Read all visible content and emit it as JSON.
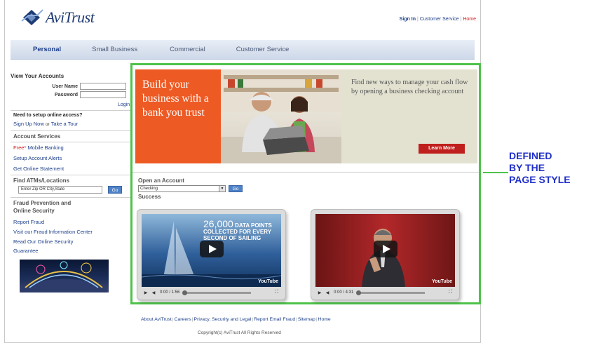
{
  "brand": {
    "name": "AviTrust"
  },
  "header": {
    "sign_in": "Sign In",
    "customer_service": "Customer Service",
    "home": "Home"
  },
  "nav": {
    "tabs": [
      "Personal",
      "Small Business",
      "Commercial",
      "Customer Service"
    ],
    "active": "Personal"
  },
  "sidebar": {
    "accounts_title": "View Your Accounts",
    "username_label": "User Name",
    "password_label": "Password",
    "login": "Login",
    "need_setup": "Need to setup online access?",
    "sign_up_now": "Sign Up Now",
    "or": "or",
    "take_tour": "Take a Tour",
    "services_title": "Account Services",
    "free_badge": "Free*",
    "mobile_banking": "Mobile Banking",
    "setup_alerts": "Setup Account Alerts",
    "online_statement": "Get Online Statement",
    "find_atms_title": "Find ATMs/Locations",
    "zip_placeholder": "Enter Zip OR City,State",
    "go": "Go",
    "fraud_title_1": "Fraud Prevention and",
    "fraud_title_2": "Online Security",
    "report_fraud": "Report Fraud",
    "fraud_center": "Visit our Fraud Information Center",
    "read_security": "Read Our Online Security",
    "guarantee": "Guarantee"
  },
  "banner": {
    "headline": "Build your business with a bank you trust",
    "right_text": "Find new ways to manage your cash flow by opening a business checking account",
    "learn_more": "Learn More"
  },
  "open_account": {
    "title": "Open an Account",
    "selected": "Checking",
    "go": "Go",
    "success": "Success"
  },
  "videos": [
    {
      "overlay_number": "26,000",
      "overlay_text": "DATA POINTS COLLECTED FOR EVERY SECOND OF SAILING",
      "time": "0:00 / 1:56",
      "logo": "YouTube"
    },
    {
      "time": "0:00 / 4:31",
      "logo": "YouTube"
    }
  ],
  "footer": {
    "links": [
      "About AviTrust",
      "Careers",
      "Privacy, Security and Legal",
      "Report Email Fraud",
      "Sitemap",
      "Home"
    ],
    "copyright": "Copyright(c) AviTrust All Rights Reserved"
  },
  "annotation": {
    "line1": "DEFINED",
    "line2": "BY THE",
    "line3": "PAGE STYLE",
    "color": "#1f2fc8",
    "frame_color": "#4fc24a"
  }
}
